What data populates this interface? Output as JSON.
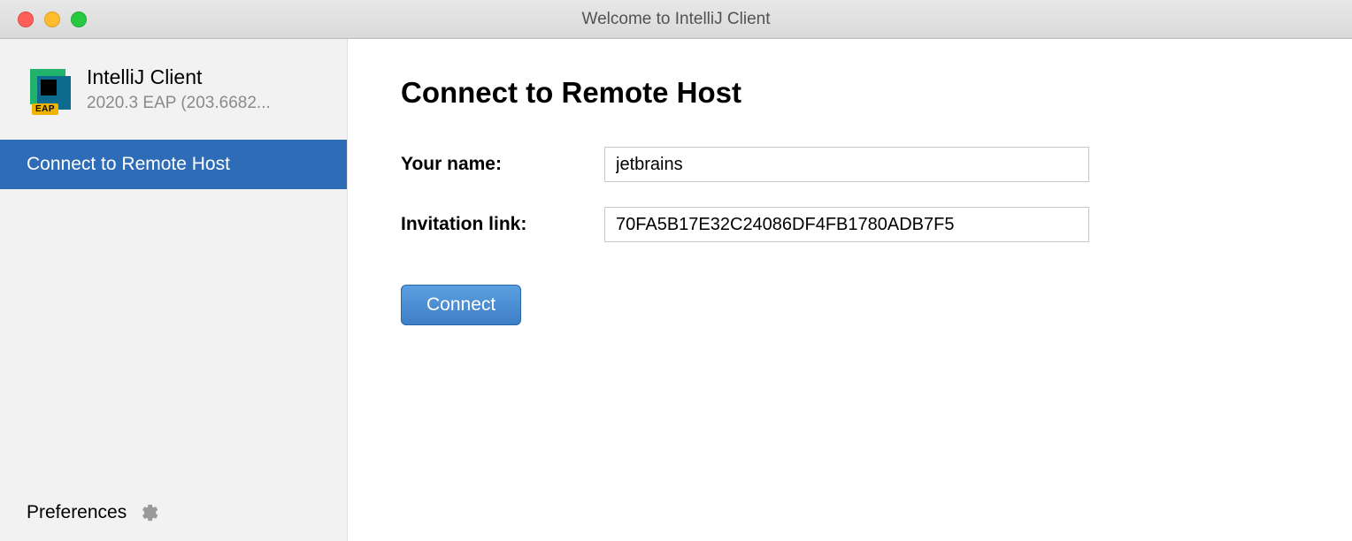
{
  "window": {
    "title": "Welcome to IntelliJ Client"
  },
  "sidebar": {
    "app_name": "IntelliJ Client",
    "app_version": "2020.3 EAP (203.6682...",
    "eap_badge": "EAP",
    "nav_item": "Connect to Remote Host",
    "preferences_label": "Preferences"
  },
  "main": {
    "heading": "Connect to Remote Host",
    "name_label": "Your name:",
    "name_value": "jetbrains",
    "link_label": "Invitation link:",
    "link_value": "70FA5B17E32C24086DF4FB1780ADB7F5",
    "connect_button": "Connect"
  }
}
